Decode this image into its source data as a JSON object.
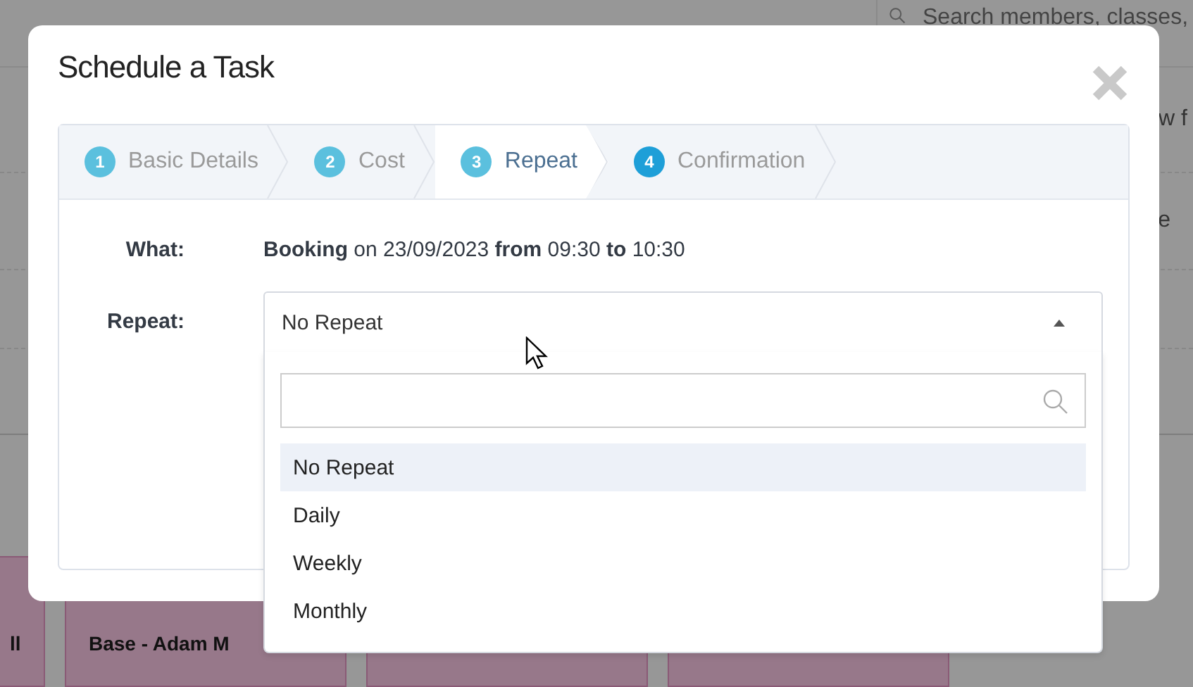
{
  "background": {
    "search": {
      "placeholder": "Search members, classes,"
    },
    "side_texts": [
      "w f",
      "e"
    ],
    "cards": [
      {
        "title": "ll"
      },
      {
        "title": "Base - Adam M"
      }
    ]
  },
  "dialog": {
    "title": "Schedule a Task",
    "steps": [
      {
        "number": "1",
        "label": "Basic Details",
        "selected": false,
        "color": "#5bc0de"
      },
      {
        "number": "2",
        "label": "Cost",
        "selected": false,
        "color": "#5bc0de"
      },
      {
        "number": "3",
        "label": "Repeat",
        "selected": true,
        "color": "#5bc0de"
      },
      {
        "number": "4",
        "label": "Confirmation",
        "selected": false,
        "color": "#1e9fd8"
      }
    ],
    "what": {
      "label": "What:",
      "value": "**Booking** on 23/09/2023 **from** 09:30 **to** 10:30"
    },
    "repeat": {
      "label": "Repeat:",
      "value": "No Repeat",
      "expanded": true,
      "options": [
        {
          "label": "No Repeat",
          "selected": true
        },
        {
          "label": "Daily",
          "selected": false
        },
        {
          "label": "Weekly",
          "selected": false
        },
        {
          "label": "Monthly",
          "selected": false
        }
      ]
    }
  }
}
